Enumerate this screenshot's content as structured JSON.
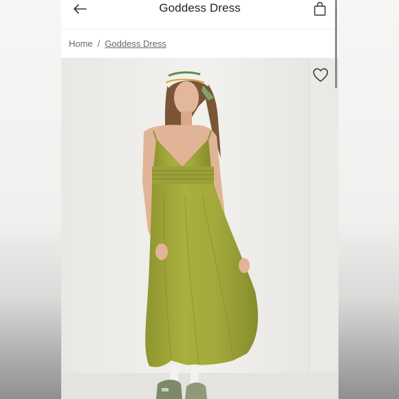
{
  "header": {
    "title": "Goddess Dress",
    "back_icon": "arrow-left-icon",
    "bag_icon": "shopping-bag-icon"
  },
  "breadcrumb": {
    "home": "Home",
    "separator": "/",
    "current": "Goddess Dress"
  },
  "product_image": {
    "wishlist_icon": "heart-outline-icon",
    "dress_color": "#a3a83a"
  }
}
